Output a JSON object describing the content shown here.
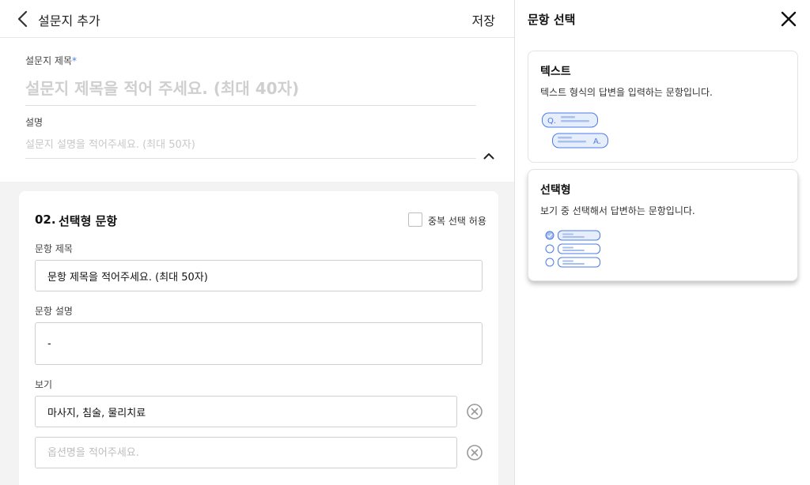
{
  "header": {
    "title": "설문지 추가",
    "save_label": "저장"
  },
  "survey": {
    "title_label": "설문지 제목",
    "title_required_mark": "*",
    "title_placeholder": "설문지 제목을 적어 주세요. (최대 40자)",
    "desc_label": "설명",
    "desc_placeholder": "설문지 설명을 적어주세요. (최대 50자)"
  },
  "question": {
    "number": "02.",
    "type_label": "선택형 문항",
    "multi_select_label": "중복 선택 허용",
    "multi_select_checked": false,
    "title_label": "문항 제목",
    "title_value": "문항 제목을 적어주세요. (최대 50자)",
    "desc_label": "문항 설명",
    "desc_value": "-",
    "options_label": "보기",
    "options": [
      {
        "value": "마사지, 침술, 물리치료",
        "placeholder": ""
      },
      {
        "value": "",
        "placeholder": "옵션명을 적어주세요."
      }
    ]
  },
  "panel": {
    "title": "문항 선택",
    "types": [
      {
        "name": "텍스트",
        "description": "텍스트 형식의 답변을 입력하는 문항입니다.",
        "icon": "text-question-illustration",
        "q_mark": "Q.",
        "a_mark": "A."
      },
      {
        "name": "선택형",
        "description": "보기 중 선택해서 답변하는 문항입니다.",
        "icon": "choice-question-illustration"
      }
    ]
  },
  "colors": {
    "accent": "#4a7be6",
    "illustration_fill": "#e6eefc",
    "background": "#f3f3f3"
  }
}
